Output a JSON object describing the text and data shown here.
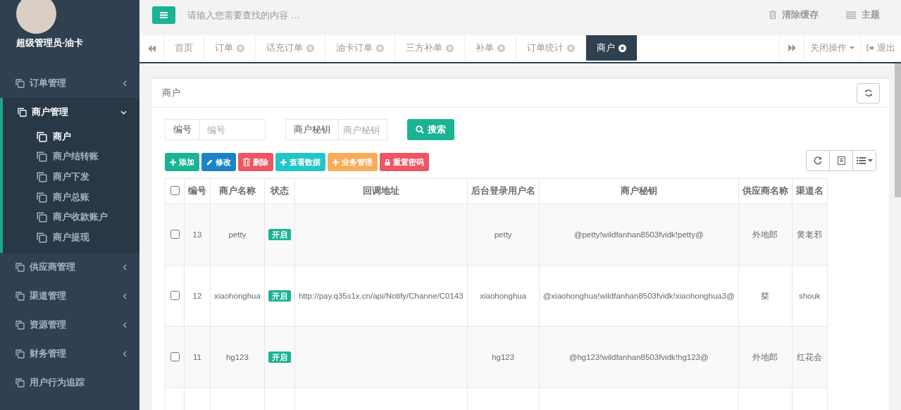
{
  "sidebar": {
    "user_name": "超级管理员-油卡",
    "items": [
      {
        "label": "订单管理",
        "kind": "group",
        "expanded": false
      },
      {
        "label": "商户管理",
        "kind": "group",
        "expanded": true,
        "children": [
          {
            "label": "商户",
            "selected": true
          },
          {
            "label": "商户结转账",
            "selected": false
          },
          {
            "label": "商户下发",
            "selected": false
          },
          {
            "label": "商户总账",
            "selected": false
          },
          {
            "label": "商户收款账户",
            "selected": false
          },
          {
            "label": "商户提现",
            "selected": false
          }
        ]
      },
      {
        "label": "供应商管理",
        "kind": "group",
        "expanded": false
      },
      {
        "label": "渠道管理",
        "kind": "group",
        "expanded": false
      },
      {
        "label": "资源管理",
        "kind": "group",
        "expanded": false
      },
      {
        "label": "财务管理",
        "kind": "group",
        "expanded": false
      },
      {
        "label": "用户行为追踪",
        "kind": "link"
      }
    ]
  },
  "topbar": {
    "search_placeholder": "请输入您需要查找的内容 …",
    "actions": [
      {
        "label": "清除缓存",
        "kind": "trash"
      },
      {
        "label": "主题",
        "kind": "theme"
      }
    ]
  },
  "tabs": {
    "items": [
      {
        "label": "首页",
        "selected": false,
        "closable": false
      },
      {
        "label": "订单",
        "selected": false,
        "closable": true
      },
      {
        "label": "话充订单",
        "selected": false,
        "closable": true
      },
      {
        "label": "油卡订单",
        "selected": false,
        "closable": true
      },
      {
        "label": "三方补单",
        "selected": false,
        "closable": true
      },
      {
        "label": "补单",
        "selected": false,
        "closable": true
      },
      {
        "label": "订单统计",
        "selected": false,
        "closable": true
      },
      {
        "label": "商户",
        "selected": true,
        "closable": true
      }
    ],
    "close_menu": "关闭操作",
    "logout": "退出"
  },
  "panel": {
    "title": "商户",
    "search_fields": [
      {
        "label": "编号",
        "placeholder": "编号"
      },
      {
        "label": "商户秘钥",
        "placeholder": "商户秘钥"
      }
    ],
    "search_button": "搜索",
    "toolbar": [
      {
        "label": "添加",
        "kind": "plus",
        "color": "#1ab394"
      },
      {
        "label": "修改",
        "kind": "pencil",
        "color": "#1c84c6"
      },
      {
        "label": "删除",
        "kind": "trash",
        "color": "#ed5565"
      },
      {
        "label": "查看数据",
        "kind": "plus",
        "color": "#23c6c8"
      },
      {
        "label": "业务管理",
        "kind": "plus",
        "color": "#f8ac59"
      },
      {
        "label": "重置密码",
        "kind": "lock",
        "color": "#ed5565"
      }
    ],
    "table": {
      "all_checked": false,
      "columns": [
        "编号",
        "商户名称",
        "状态",
        "回调地址",
        "后台登录用户名",
        "商户秘钥",
        "供应商名称",
        "渠道名"
      ],
      "rows": [
        {
          "checked": false,
          "id": "13",
          "name": "petty",
          "status": "开启",
          "callback_url": "",
          "login_name": "petty",
          "secret": "@petty!wildfanhan8503fvidk!petty@",
          "supplier": "外地郎",
          "channel": "黄老邪"
        },
        {
          "checked": false,
          "id": "12",
          "name": "xiaohonghua",
          "status": "开启",
          "callback_url": "http://pay.q35s1x.cn/api/Notify/Channe/C0143",
          "login_name": "xiaohonghua",
          "secret": "@xiaohonghua!wildfanhan8503fvidk!xiaohonghua3@",
          "supplier": "桀",
          "channel": "shouk"
        },
        {
          "checked": false,
          "id": "11",
          "name": "hg123",
          "status": "开启",
          "callback_url": "",
          "login_name": "hg123",
          "secret": "@hg123!wildfanhan8503fvidk!hg123@",
          "supplier": "外地郎",
          "channel": "红花会"
        }
      ]
    }
  }
}
